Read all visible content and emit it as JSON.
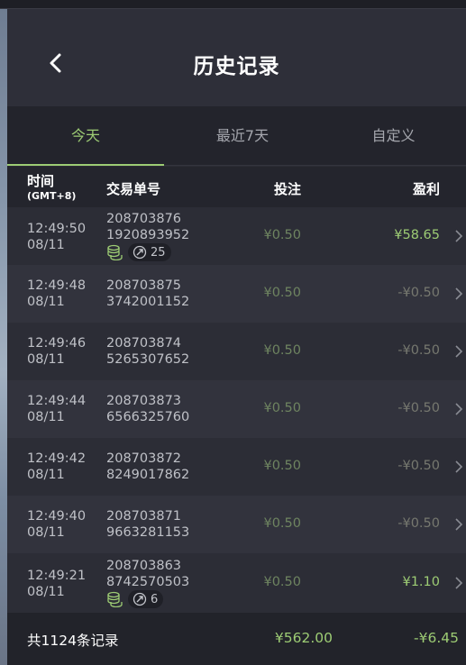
{
  "header": {
    "title": "历史记录"
  },
  "tabs": [
    {
      "label": "今天",
      "active": true
    },
    {
      "label": "最近7天",
      "active": false
    },
    {
      "label": "自定义",
      "active": false
    }
  ],
  "columns": {
    "time": "时间",
    "timezone": "(GMT+8)",
    "order": "交易单号",
    "bet": "投注",
    "profit": "盈利"
  },
  "rows": [
    {
      "time": "12:49:50",
      "date": "08/11",
      "order_line1": "208703876",
      "order_line2": "1920893952",
      "bet": "¥0.50",
      "profit": "¥58.65",
      "positive": true,
      "badge_count": "25"
    },
    {
      "time": "12:49:48",
      "date": "08/11",
      "order_line1": "208703875",
      "order_line2": "3742001152",
      "bet": "¥0.50",
      "profit": "-¥0.50",
      "positive": false
    },
    {
      "time": "12:49:46",
      "date": "08/11",
      "order_line1": "208703874",
      "order_line2": "5265307652",
      "bet": "¥0.50",
      "profit": "-¥0.50",
      "positive": false
    },
    {
      "time": "12:49:44",
      "date": "08/11",
      "order_line1": "208703873",
      "order_line2": "6566325760",
      "bet": "¥0.50",
      "profit": "-¥0.50",
      "positive": false
    },
    {
      "time": "12:49:42",
      "date": "08/11",
      "order_line1": "208703872",
      "order_line2": "8249017862",
      "bet": "¥0.50",
      "profit": "-¥0.50",
      "positive": false
    },
    {
      "time": "12:49:40",
      "date": "08/11",
      "order_line1": "208703871",
      "order_line2": "9663281153",
      "bet": "¥0.50",
      "profit": "-¥0.50",
      "positive": false
    },
    {
      "time": "12:49:21",
      "date": "08/11",
      "order_line1": "208703863",
      "order_line2": "8742570503",
      "bet": "¥0.50",
      "profit": "¥1.10",
      "positive": true,
      "badge_count": "6"
    }
  ],
  "footer": {
    "count_label": "共1124条记录",
    "total_bet": "¥562.00",
    "total_profit": "-¥6.45"
  },
  "colors": {
    "accent": "#9dcc74",
    "background": "#2b2c35",
    "header": "#2e2f39"
  },
  "icons": {
    "back": "chevron-left-icon",
    "row_arrow": "chevron-right-icon",
    "coins": "coin-stack-icon",
    "free_spin": "spin-arrow-icon"
  }
}
